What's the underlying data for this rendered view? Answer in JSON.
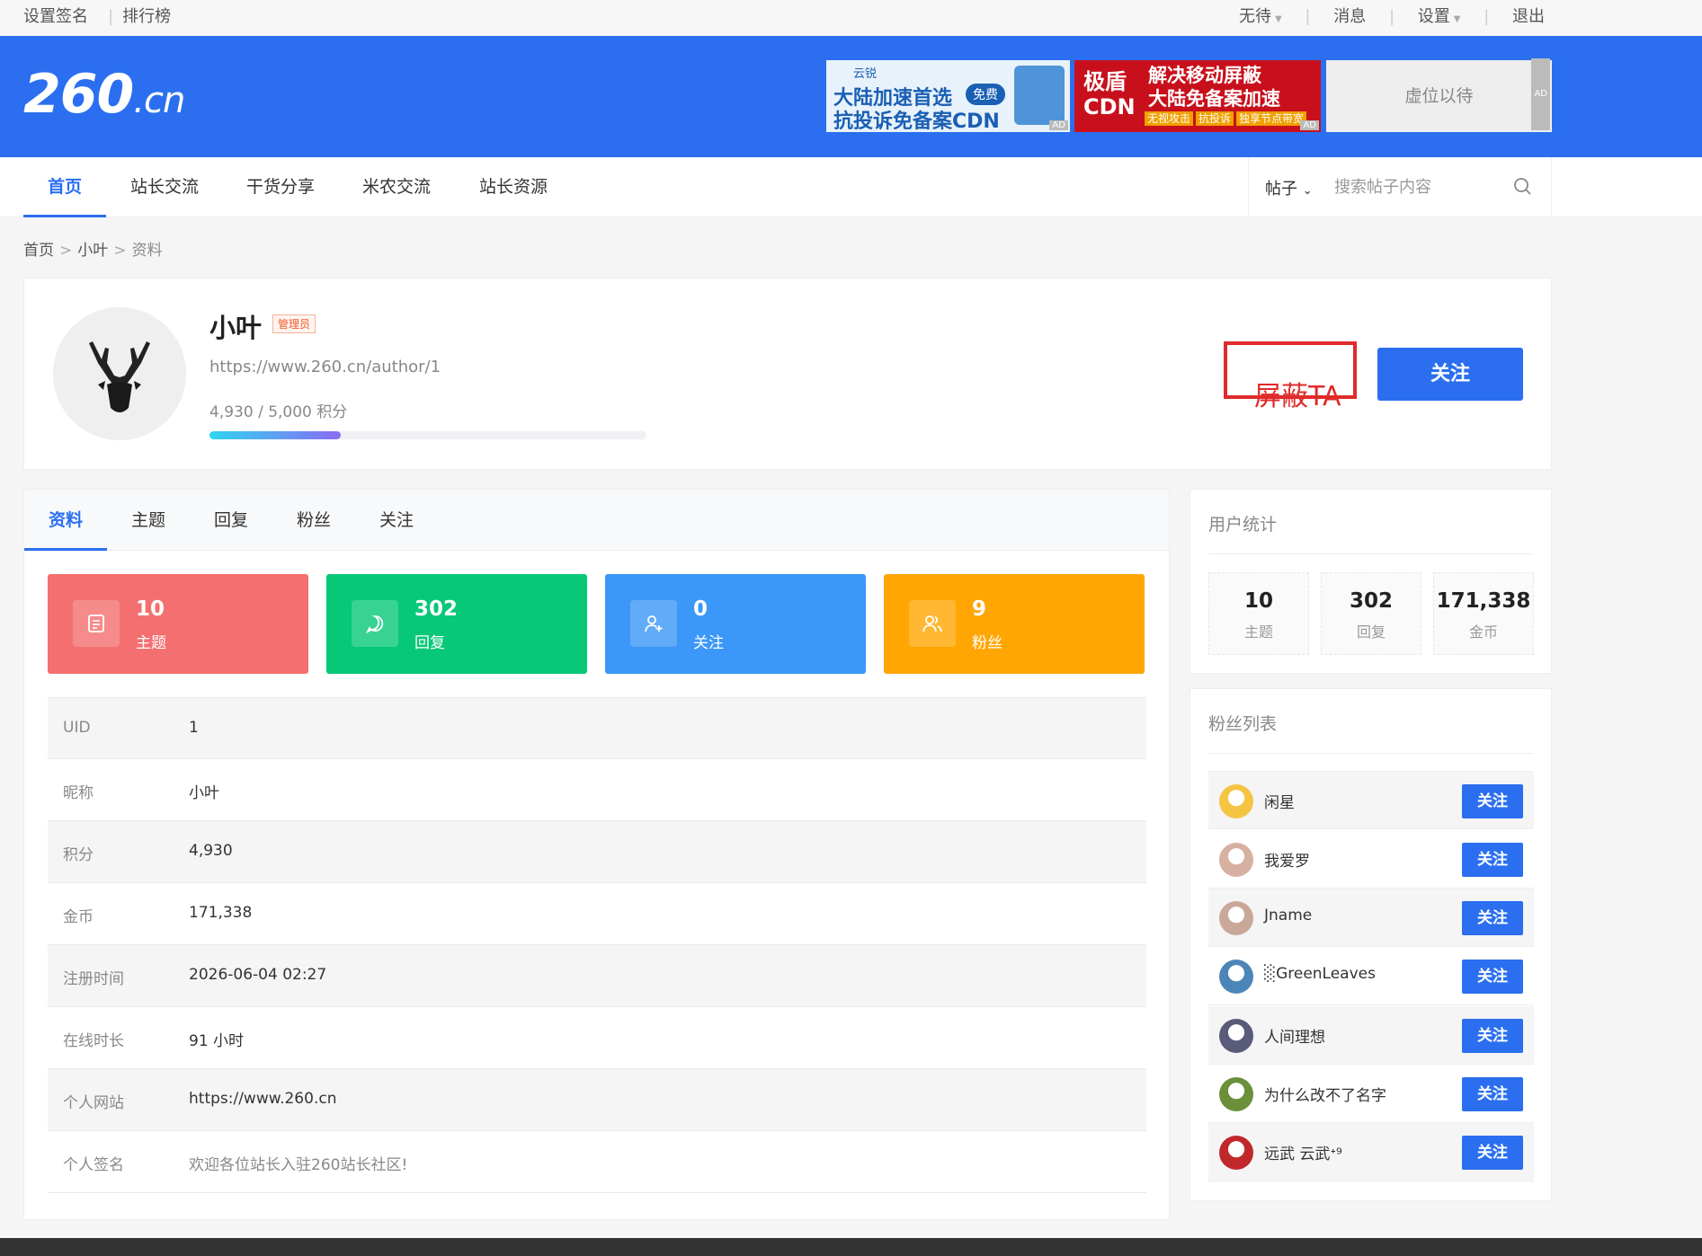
{
  "topbar": {
    "left": [
      "设置签名",
      "排行榜"
    ],
    "right": [
      "无待",
      "消息",
      "设置",
      "退出"
    ]
  },
  "header": {
    "logo_main": "260",
    "logo_suffix": ".cn",
    "ads": {
      "ad1": {
        "brand": "云锐",
        "line1": "大陆加速首选",
        "badge": "免费",
        "line2": "抗投诉免备案CDN",
        "tag": "AD"
      },
      "ad2": {
        "brand_line1": "极盾",
        "brand_line2": "CDN",
        "line1": "解决移动屏蔽",
        "line2": "大陆免备案加速",
        "chips": [
          "无视攻击",
          "抗投诉",
          "独享节点带宽"
        ],
        "tag": "AD"
      },
      "ad3": {
        "text": "虚位以待",
        "tag": "AD"
      }
    }
  },
  "nav": {
    "items": [
      "首页",
      "站长交流",
      "干货分享",
      "米农交流",
      "站长资源"
    ],
    "search_scope": "帖子",
    "search_placeholder": "搜索帖子内容"
  },
  "breadcrumb": [
    "首页",
    "小叶",
    "资料"
  ],
  "profile": {
    "name": "小叶",
    "role": "管理员",
    "url": "https://www.260.cn/author/1",
    "points_text": "4,930 / 5,000 积分",
    "points_fraction": 0.3,
    "block_label": "屏蔽TA",
    "follow_label": "关注"
  },
  "tabs": [
    "资料",
    "主题",
    "回复",
    "粉丝",
    "关注"
  ],
  "cards": [
    {
      "num": "10",
      "label": "主题",
      "color": "#f46f6f",
      "icon": "document-icon"
    },
    {
      "num": "302",
      "label": "回复",
      "color": "#07c877",
      "icon": "chat-icon"
    },
    {
      "num": "0",
      "label": "关注",
      "color": "#3b97f8",
      "icon": "user-add-icon"
    },
    {
      "num": "9",
      "label": "粉丝",
      "color": "#ffa602",
      "icon": "users-icon"
    }
  ],
  "info": [
    {
      "k": "UID",
      "v": "1"
    },
    {
      "k": "昵称",
      "v": "小叶"
    },
    {
      "k": "积分",
      "v": "4,930"
    },
    {
      "k": "金币",
      "v": "171,338"
    },
    {
      "k": "注册时间",
      "v": "2026-06-04 02:27"
    },
    {
      "k": "在线时长",
      "v": "91 小时"
    },
    {
      "k": "个人网站",
      "v": "https://www.260.cn"
    },
    {
      "k": "个人签名",
      "v": "欢迎各位站长入驻260站长社区!"
    }
  ],
  "stats": {
    "title": "用户统计",
    "items": [
      {
        "n": "10",
        "l": "主题"
      },
      {
        "n": "302",
        "l": "回复"
      },
      {
        "n": "171,338",
        "l": "金币"
      }
    ]
  },
  "fans": {
    "title": "粉丝列表",
    "follow_label": "关注",
    "items": [
      {
        "name": "闲星",
        "color": "#f4c542"
      },
      {
        "name": "我爱罗",
        "color": "#d6b0a0"
      },
      {
        "name": "Jname",
        "color": "#c9a89a"
      },
      {
        "name": "░GreenLeaves",
        "color": "#4c86b8"
      },
      {
        "name": "人间理想",
        "color": "#5a5a7a"
      },
      {
        "name": "为什么改不了名字",
        "color": "#6b8f3a"
      },
      {
        "name": "远武 云武ᐩ⁹",
        "color": "#c0282c"
      }
    ]
  }
}
